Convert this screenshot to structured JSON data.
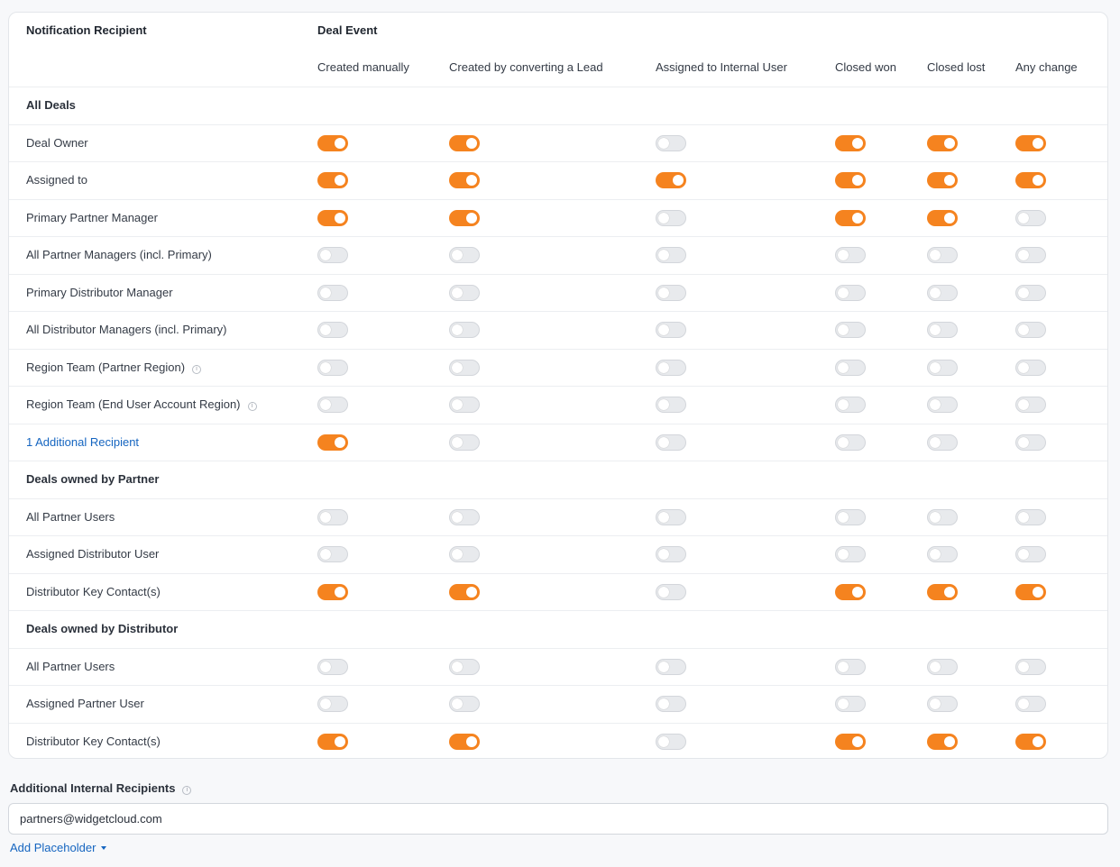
{
  "table": {
    "recipient_header": "Notification Recipient",
    "event_header": "Deal Event",
    "columns": [
      "Created manually",
      "Created by converting a Lead",
      "Assigned to Internal User",
      "Closed won",
      "Closed lost",
      "Any change"
    ],
    "rows": [
      {
        "type": "section",
        "label": "All Deals"
      },
      {
        "type": "row",
        "label": "Deal Owner",
        "toggles": [
          true,
          true,
          false,
          true,
          true,
          true
        ]
      },
      {
        "type": "row",
        "label": "Assigned to",
        "toggles": [
          true,
          true,
          true,
          true,
          true,
          true
        ]
      },
      {
        "type": "row",
        "label": "Primary Partner Manager",
        "toggles": [
          true,
          true,
          false,
          true,
          true,
          false
        ]
      },
      {
        "type": "row",
        "label": "All Partner Managers (incl. Primary)",
        "toggles": [
          false,
          false,
          false,
          false,
          false,
          false
        ]
      },
      {
        "type": "row",
        "label": "Primary Distributor Manager",
        "toggles": [
          false,
          false,
          false,
          false,
          false,
          false
        ]
      },
      {
        "type": "row",
        "label": "All Distributor Managers (incl. Primary)",
        "toggles": [
          false,
          false,
          false,
          false,
          false,
          false
        ]
      },
      {
        "type": "row",
        "label": "Region Team (Partner Region)",
        "info": true,
        "toggles": [
          false,
          false,
          false,
          false,
          false,
          false
        ]
      },
      {
        "type": "row",
        "label": "Region Team (End User Account Region)",
        "info": true,
        "toggles": [
          false,
          false,
          false,
          false,
          false,
          false
        ]
      },
      {
        "type": "row",
        "label": "1 Additional Recipient",
        "link": true,
        "toggles": [
          true,
          false,
          false,
          false,
          false,
          false
        ]
      },
      {
        "type": "section",
        "label": "Deals owned by Partner"
      },
      {
        "type": "row",
        "label": "All Partner Users",
        "toggles": [
          false,
          false,
          false,
          false,
          false,
          false
        ]
      },
      {
        "type": "row",
        "label": "Assigned Distributor User",
        "toggles": [
          false,
          false,
          false,
          false,
          false,
          false
        ]
      },
      {
        "type": "row",
        "label": "Distributor Key Contact(s)",
        "toggles": [
          true,
          true,
          false,
          true,
          true,
          true
        ]
      },
      {
        "type": "section",
        "label": "Deals owned by Distributor"
      },
      {
        "type": "row",
        "label": "All Partner Users",
        "toggles": [
          false,
          false,
          false,
          false,
          false,
          false
        ]
      },
      {
        "type": "row",
        "label": "Assigned Partner User",
        "toggles": [
          false,
          false,
          false,
          false,
          false,
          false
        ]
      },
      {
        "type": "row",
        "label": "Distributor Key Contact(s)",
        "toggles": [
          true,
          true,
          false,
          true,
          true,
          true
        ]
      }
    ]
  },
  "additional": {
    "label": "Additional Internal Recipients",
    "value": "partners@widgetcloud.com",
    "add_placeholder": "Add Placeholder"
  },
  "colors": {
    "toggle_on": "#f5831f",
    "toggle_off": "#e8eaed",
    "link": "#1565c0"
  }
}
